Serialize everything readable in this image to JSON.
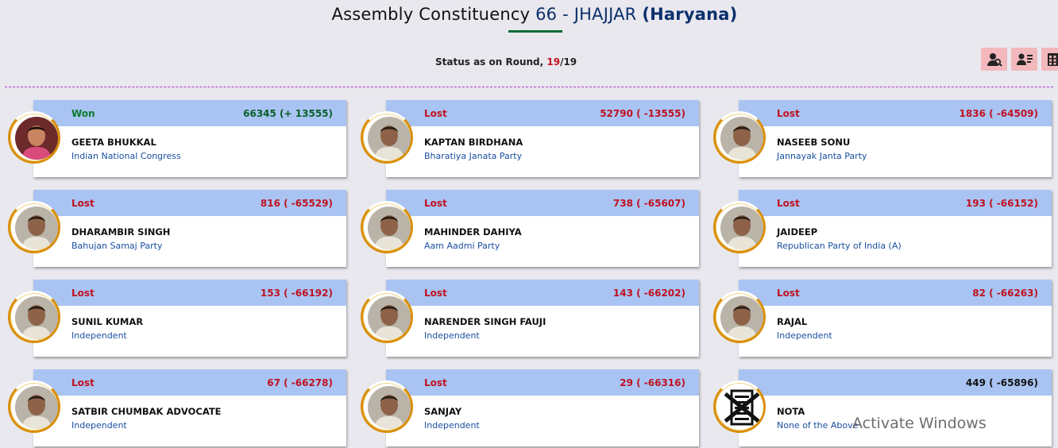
{
  "header": {
    "title_prefix": "Assembly Constituency",
    "constituency_number": "66 - JHAJJAR",
    "state": "(Haryana)",
    "status_label": "Status as on Round,",
    "round_current": "19",
    "round_total": "/19"
  },
  "toolbar": {
    "icons": [
      "candidate-search-icon",
      "candidate-list-icon",
      "table-view-icon"
    ],
    "accent_color": "#f2b8bc"
  },
  "candidates": [
    {
      "result": "Won",
      "votes": "66345 (+ 13555)",
      "name": "GEETA BHUKKAL",
      "party": "Indian National Congress",
      "photo": "female"
    },
    {
      "result": "Lost",
      "votes": "52790 ( -13555)",
      "name": "KAPTAN BIRDHANA",
      "party": "Bharatiya Janata Party",
      "photo": "male"
    },
    {
      "result": "Lost",
      "votes": "1836 ( -64509)",
      "name": "NASEEB SONU",
      "party": "Jannayak Janta Party",
      "photo": "male"
    },
    {
      "result": "Lost",
      "votes": "816 ( -65529)",
      "name": "DHARAMBIR SINGH",
      "party": "Bahujan Samaj Party",
      "photo": "male"
    },
    {
      "result": "Lost",
      "votes": "738 ( -65607)",
      "name": "MAHINDER DAHIYA",
      "party": "Aam Aadmi Party",
      "photo": "male"
    },
    {
      "result": "Lost",
      "votes": "193 ( -66152)",
      "name": "JAIDEEP",
      "party": "Republican Party of India (A)",
      "photo": "male"
    },
    {
      "result": "Lost",
      "votes": "153 ( -66192)",
      "name": "SUNIL KUMAR",
      "party": "Independent",
      "photo": "male"
    },
    {
      "result": "Lost",
      "votes": "143 ( -66202)",
      "name": "NARENDER SINGH FAUJI",
      "party": "Independent",
      "photo": "male"
    },
    {
      "result": "Lost",
      "votes": "82 ( -66263)",
      "name": "RAJAL",
      "party": "Independent",
      "photo": "male"
    },
    {
      "result": "Lost",
      "votes": "67 ( -66278)",
      "name": "SATBIR CHUMBAK ADVOCATE",
      "party": "Independent",
      "photo": "male"
    },
    {
      "result": "Lost",
      "votes": "29 ( -66316)",
      "name": "SANJAY",
      "party": "Independent",
      "photo": "male"
    },
    {
      "result": "",
      "votes": "449 ( -65896)",
      "name": "NOTA",
      "party": "None of the Above",
      "photo": "nota"
    }
  ],
  "colors": {
    "won": "#0a7a2e",
    "lost": "#c0111f",
    "card_header": "#a9c4f2",
    "party_text": "#1a4fa0",
    "avatar_ring": "#d98e0a"
  },
  "watermark": "Activate Windows"
}
